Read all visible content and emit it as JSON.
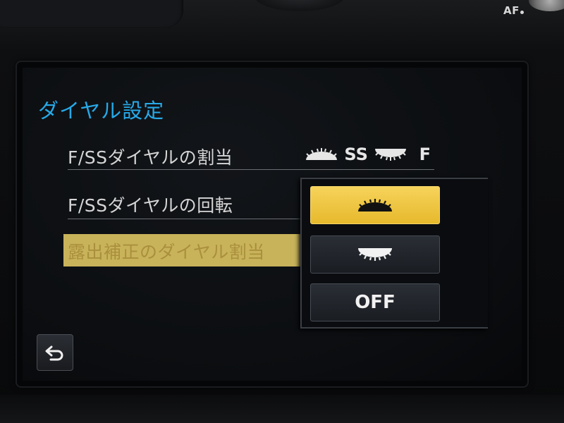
{
  "header": {
    "title": "ダイヤル設定"
  },
  "camera": {
    "af_label": "AF"
  },
  "menu": {
    "items": [
      {
        "label": "F/SSダイヤルの割当",
        "value_text_1": "SS",
        "value_text_2": "F"
      },
      {
        "label": "F/SSダイヤルの回転"
      },
      {
        "label": "露出補正のダイヤル割当",
        "selected": true
      }
    ]
  },
  "popup": {
    "options": [
      {
        "name": "front-dial",
        "selected": true
      },
      {
        "name": "rear-dial",
        "selected": false
      },
      {
        "label": "OFF",
        "selected": false
      }
    ]
  },
  "icons": {
    "back": "return-arrow-icon",
    "front_dial": "front-dial-icon",
    "rear_dial": "rear-dial-icon"
  },
  "colors": {
    "title": "#27a9e8",
    "highlight": "#c8b35a",
    "selected_option": "#f0c843"
  }
}
